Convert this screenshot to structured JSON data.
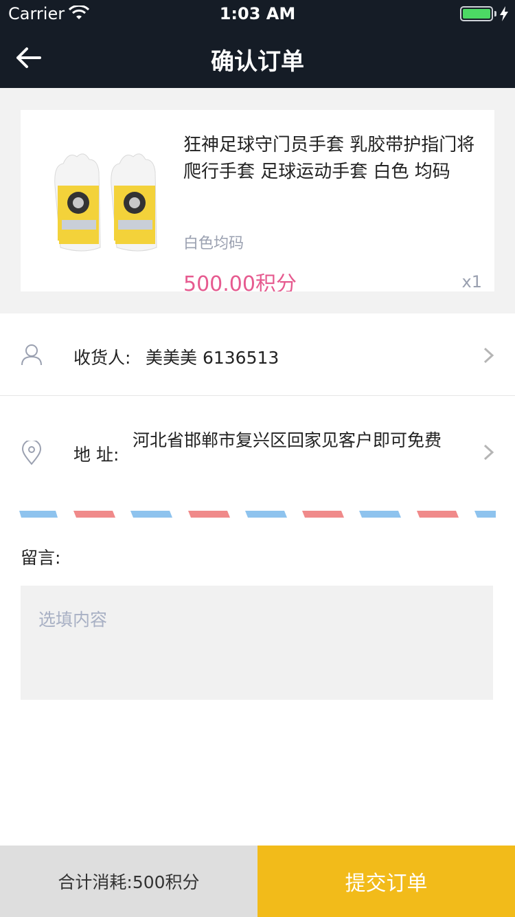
{
  "status_bar": {
    "carrier": "Carrier",
    "time": "1:03 AM"
  },
  "nav": {
    "title": "确认订单",
    "back_icon": "arrow-left-icon"
  },
  "product": {
    "title": "狂神足球守门员手套 乳胶带护指门将爬行手套 足球运动手套 白色 均码",
    "spec": "白色均码",
    "price": "500.00积分",
    "quantity": "x1"
  },
  "receiver": {
    "label": "收货人:",
    "value": "美美美 6136513"
  },
  "address": {
    "label": "地 址:",
    "value": "河北省邯郸市复兴区回家见客户即可免费"
  },
  "message": {
    "label": "留言:",
    "placeholder": "选填内容",
    "value": ""
  },
  "footer": {
    "total": "合计消耗:500积分",
    "submit_label": "提交订单"
  },
  "colors": {
    "header_bg": "#151c26",
    "price": "#e65a8f",
    "submit_bg": "#f2bb1a",
    "total_bg": "#dedede",
    "stripe_blue": "#8ec3ee",
    "stripe_red": "#f08a8a"
  }
}
